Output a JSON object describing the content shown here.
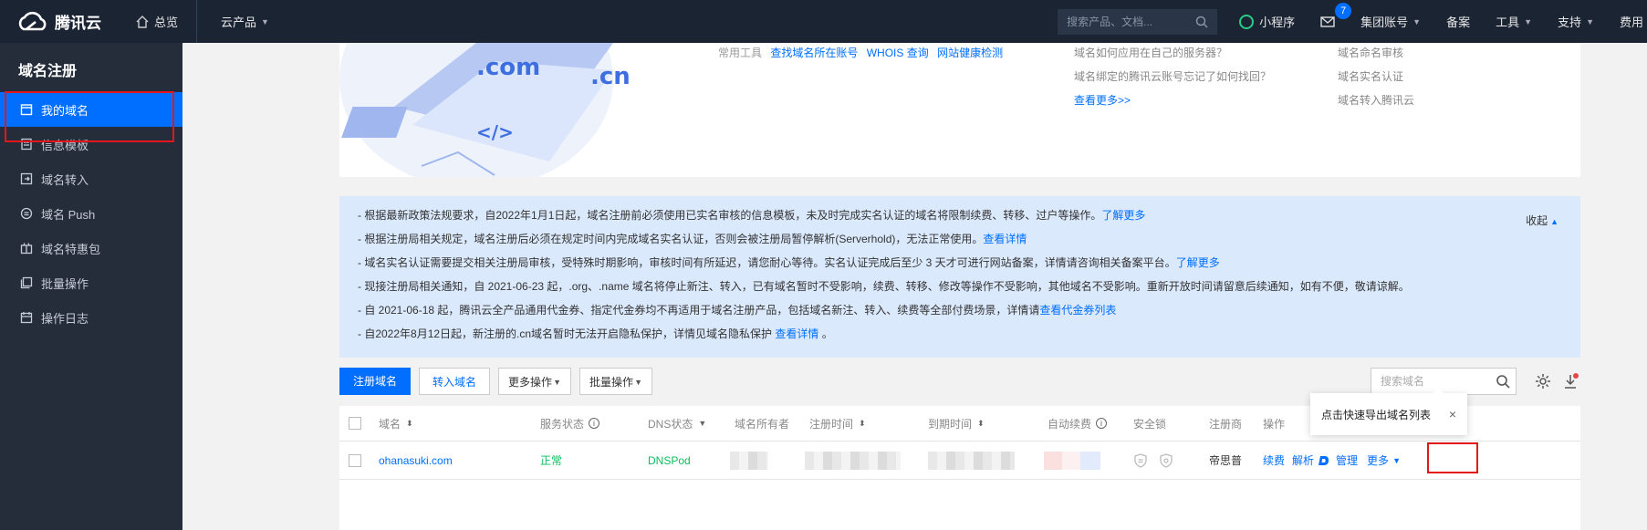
{
  "topbar": {
    "brand": "腾讯云",
    "overview": "总览",
    "products": "云产品",
    "search_placeholder": "搜索产品、文档...",
    "mini_program": "小程序",
    "message_count": "7",
    "group_account": "集团账号",
    "record": "备案",
    "tools": "工具",
    "support": "支持",
    "fees": "费用"
  },
  "sidebar": {
    "title": "域名注册",
    "items": [
      {
        "label": "我的域名",
        "icon": "calendar-icon"
      },
      {
        "label": "信息模板",
        "icon": "template-icon"
      },
      {
        "label": "域名转入",
        "icon": "transfer-icon"
      },
      {
        "label": "域名 Push",
        "icon": "push-icon"
      },
      {
        "label": "域名特惠包",
        "icon": "gift-icon"
      },
      {
        "label": "批量操作",
        "icon": "batch-icon"
      },
      {
        "label": "操作日志",
        "icon": "log-icon"
      }
    ]
  },
  "banner": {
    "tools_label": "常用工具",
    "tools": [
      "查找域名所在账号",
      "WHOIS 查询",
      "网站健康检测"
    ],
    "faq": [
      "域名如何应用在自己的服务器？",
      "域名绑定的腾讯云账号忘记了如何找回？",
      "查看更多>>"
    ],
    "faq2": [
      "域名命名审核",
      "域名实名认证",
      "域名转入腾讯云"
    ],
    "art_text": [
      ".com",
      ".cn",
      "</>"
    ]
  },
  "notice": {
    "collapse": "收起",
    "lines": [
      {
        "text": "- 根据最新政策法规要求，自2022年1月1日起，域名注册前必须使用已实名审核的信息模板，未及时完成实名认证的域名将限制续费、转移、过户等操作。",
        "link": "了解更多"
      },
      {
        "text": "- 根据注册局相关规定，域名注册后必须在规定时间内完成域名实名认证，否则会被注册局暂停解析(Serverhold)，无法正常使用。",
        "link": "查看详情"
      },
      {
        "text": "- 域名实名认证需要提交相关注册局审核，受特殊时期影响，审核时间有所延迟，请您耐心等待。实名认证完成后至少 3 天才可进行网站备案，详情请咨询相关备案平台。",
        "link": "了解更多"
      },
      {
        "text": "- 现接注册局相关通知，自 2021-06-23 起，.org、.name 域名将停止新注、转入，已有域名暂时不受影响，续费、转移、修改等操作不受影响，其他域名不受影响。重新开放时间请留意后续通知，如有不便，敬请谅解。",
        "link": ""
      },
      {
        "text": "- 自 2021-06-18 起，腾讯云全产品通用代金券、指定代金券均不再适用于域名注册产品，包括域名新注、转入、续费等全部付费场景，详情请",
        "link": "查看代金券列表"
      },
      {
        "text": "- 自2022年8月12日起，新注册的.cn域名暂时无法开启隐私保护，详情见域名隐私保护 ",
        "link": "查看详情",
        "suffix": " 。"
      }
    ]
  },
  "toolbar": {
    "register": "注册域名",
    "transfer_in": "转入域名",
    "more_ops": "更多操作",
    "batch_ops": "批量操作",
    "search_placeholder": "搜索域名"
  },
  "table": {
    "headers": [
      "域名",
      "服务状态",
      "DNS状态",
      "域名所有者",
      "注册时间",
      "到期时间",
      "自动续费",
      "安全锁",
      "注册商",
      "操作"
    ],
    "rows": [
      {
        "domain": "ohanasuki.com",
        "status": "正常",
        "dns": "DNSPod",
        "registrar": "帝思普",
        "actions": [
          "续费",
          "解析",
          "管理",
          "更多"
        ]
      }
    ]
  },
  "tooltip": {
    "text": "点击快速导出域名列表",
    "close": "×"
  },
  "colors": {
    "primary": "#006eff",
    "topbar": "#1b2433",
    "sidebar": "#252d3a",
    "highlight": "#e4161b",
    "success": "#0abf5b"
  }
}
